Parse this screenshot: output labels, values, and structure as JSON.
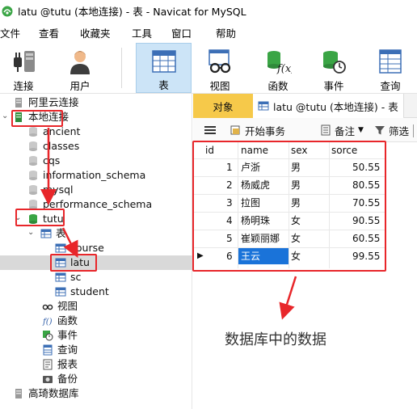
{
  "window": {
    "title": "latu @tutu (本地连接) - 表 - Navicat for MySQL"
  },
  "menu": [
    "文件",
    "查看",
    "收藏夹",
    "工具",
    "窗口",
    "帮助"
  ],
  "toolbar": [
    "连接",
    "用户",
    "表",
    "视图",
    "函数",
    "事件",
    "查询"
  ],
  "sidebar": {
    "connections": [
      "阿里云连接",
      "本地连接"
    ],
    "databases": [
      "ancient",
      "classes",
      "cqs",
      "information_schema",
      "mysql",
      "performance_schema"
    ],
    "active_db": "tutu",
    "tables_group": "表",
    "tables": [
      "course",
      "latu",
      "sc",
      "student"
    ],
    "groups": [
      "视图",
      "函数",
      "事件",
      "查询",
      "报表",
      "备份"
    ],
    "last_connection": "高琦数据库"
  },
  "tabs": {
    "object": "对象",
    "table_tab": "latu @tutu (本地连接) - 表"
  },
  "subtoolbar": {
    "begin_tx": "开始事务",
    "note": "备注",
    "filter": "筛选"
  },
  "grid": {
    "columns": [
      "id",
      "name",
      "sex",
      "sorce"
    ],
    "rows": [
      [
        "1",
        "卢浙",
        "男",
        "50.55"
      ],
      [
        "2",
        "杨威虎",
        "男",
        "80.55"
      ],
      [
        "3",
        "拉图",
        "男",
        "70.55"
      ],
      [
        "4",
        "杨明珠",
        "女",
        "90.55"
      ],
      [
        "5",
        "崔颖丽娜",
        "女",
        "60.55"
      ],
      [
        "6",
        "王云",
        "女",
        "99.55"
      ]
    ]
  },
  "caption": "数据库中的数据",
  "colors": {
    "annotation_red": "#e8262a",
    "object_tab": "#f6c94a",
    "selection_blue": "#1a73d9"
  }
}
